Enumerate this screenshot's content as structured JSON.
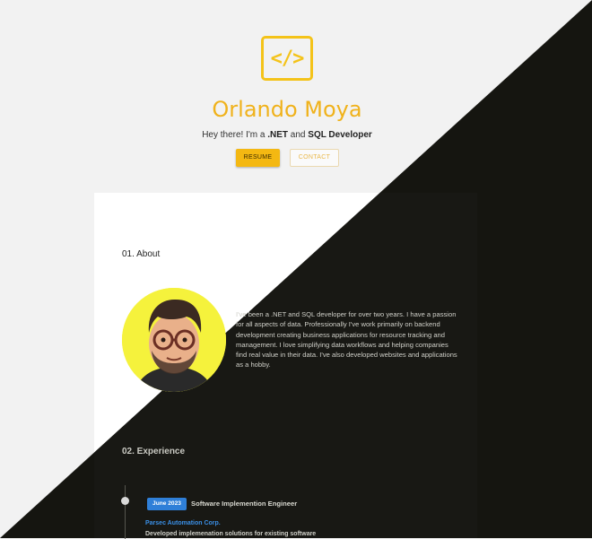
{
  "hero": {
    "logo_glyph": "</>",
    "name": "Orlando Moya",
    "tagline_pre": "Hey there! I'm a ",
    "tagline_net": ".NET",
    "tagline_mid": " and ",
    "tagline_sql": "SQL Developer",
    "resume_label": "RESUME",
    "contact_label": "CONTACT"
  },
  "about": {
    "heading": "01. About",
    "text": "I've been a .NET and SQL developer for over two years. I have a passion for all aspects of data. Professionally I've work primarily on backend development creating business applications for resource tracking and management. I love simplifying data workflows and helping companies find real value in their data. I've also developed websites and applications as a hobby."
  },
  "experience": {
    "heading": "02. Experience",
    "items": [
      {
        "date": "June 2023",
        "title": "Software Implemention Engineer",
        "company": "Parsec Automation Corp.",
        "description": "Developed implemenation solutions for existing software"
      }
    ]
  },
  "colors": {
    "accent": "#f4c319",
    "dark_bg": "#151510",
    "light_bg": "#f2f2f2",
    "badge_blue": "#2f7fd8",
    "company_blue": "#3a8fe6"
  }
}
